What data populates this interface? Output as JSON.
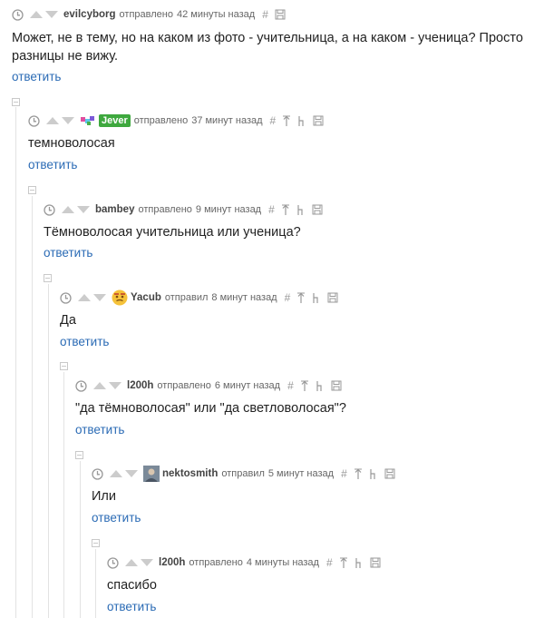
{
  "comments": [
    {
      "user": "evilcyborg",
      "action": "отправлено",
      "time": "42 минуты назад",
      "text": "Может, не в тему, но на каком из фото - учительница, а на каком - ученица? Просто разницы не вижу.",
      "reply": "ответить"
    },
    {
      "user": "Jever",
      "action": "отправлено",
      "time": "37 минут назад",
      "text": "темноволосая",
      "reply": "ответить"
    },
    {
      "user": "bambey",
      "action": "отправлено",
      "time": "9 минут назад",
      "text": "Тёмноволосая учительница или ученица?",
      "reply": "ответить"
    },
    {
      "user": "Yacub",
      "action": "отправил",
      "time": "8 минут назад",
      "text": "Да",
      "reply": "ответить"
    },
    {
      "user": "l200h",
      "action": "отправлено",
      "time": "6 минут назад",
      "text": "\"да тёмноволосая\" или \"да светловолосая\"?",
      "reply": "ответить"
    },
    {
      "user": "nektosmith",
      "action": "отправил",
      "time": "5 минут назад",
      "text": "Или",
      "reply": "ответить"
    },
    {
      "user": "l200h",
      "action": "отправлено",
      "time": "4 минуты назад",
      "text": "спасибо",
      "reply": "ответить"
    }
  ],
  "icons": {
    "hash": "#"
  },
  "colors": {
    "link": "#2b6bb5",
    "badge": "#3ea83e"
  }
}
